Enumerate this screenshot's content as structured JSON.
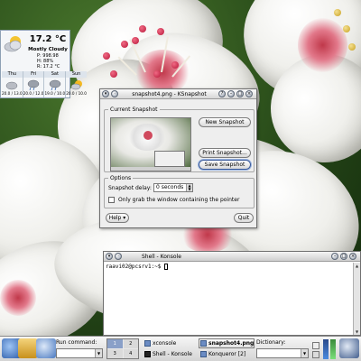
{
  "weather": {
    "temperature": "17.2 °C",
    "condition": "Mostly Cloudy",
    "pressure": "P: 998.98",
    "humidity": "H: 88%",
    "realfeel": "R: 17.2 °C",
    "icon": "partly-cloudy-icon",
    "forecast": [
      {
        "day": "Thu",
        "icon": "cloudy-icon",
        "temps": "20.0 / 13.0"
      },
      {
        "day": "Fri",
        "icon": "rain-icon",
        "temps": "20.0 / 12.0"
      },
      {
        "day": "Sat",
        "icon": "rain-icon",
        "temps": "19.0 / 10.0"
      },
      {
        "day": "Sun",
        "icon": "partly-sunny-icon",
        "temps": "20.0 / 10.0"
      }
    ]
  },
  "ksnapshot": {
    "title": "snapshot4.png - KSnapshot",
    "current_group": "Current Snapshot",
    "new_button": "New Snapshot",
    "print_button": "Print Snapshot...",
    "save_button": "Save Snapshot",
    "options_group": "Options",
    "delay_label": "Snapshot delay:",
    "delay_value": "0 seconds",
    "grab_label": "Only grab the window containing the pointer",
    "help_button": "Help",
    "quit_button": "Quit"
  },
  "konsole": {
    "title": "Shell - Konsole",
    "prompt": "raavi02@pcsrv1:~$"
  },
  "taskbar": {
    "run_label": "Run command:",
    "pager": [
      "1",
      "2",
      "3",
      "4"
    ],
    "pager_active": "1",
    "tasks": [
      {
        "label": "xconsole",
        "active": false
      },
      {
        "label": "snapshot4.png",
        "active": true
      },
      {
        "label": "Shell - Konsole",
        "active": false
      },
      {
        "label": "Konqueror [2]",
        "active": false
      }
    ],
    "dictionary_label": "Dictionary:"
  },
  "colors": {
    "accent": "#3a5a9a",
    "wallpaper_green": "#2d4a1f",
    "petal_pink": "#c0384a"
  }
}
